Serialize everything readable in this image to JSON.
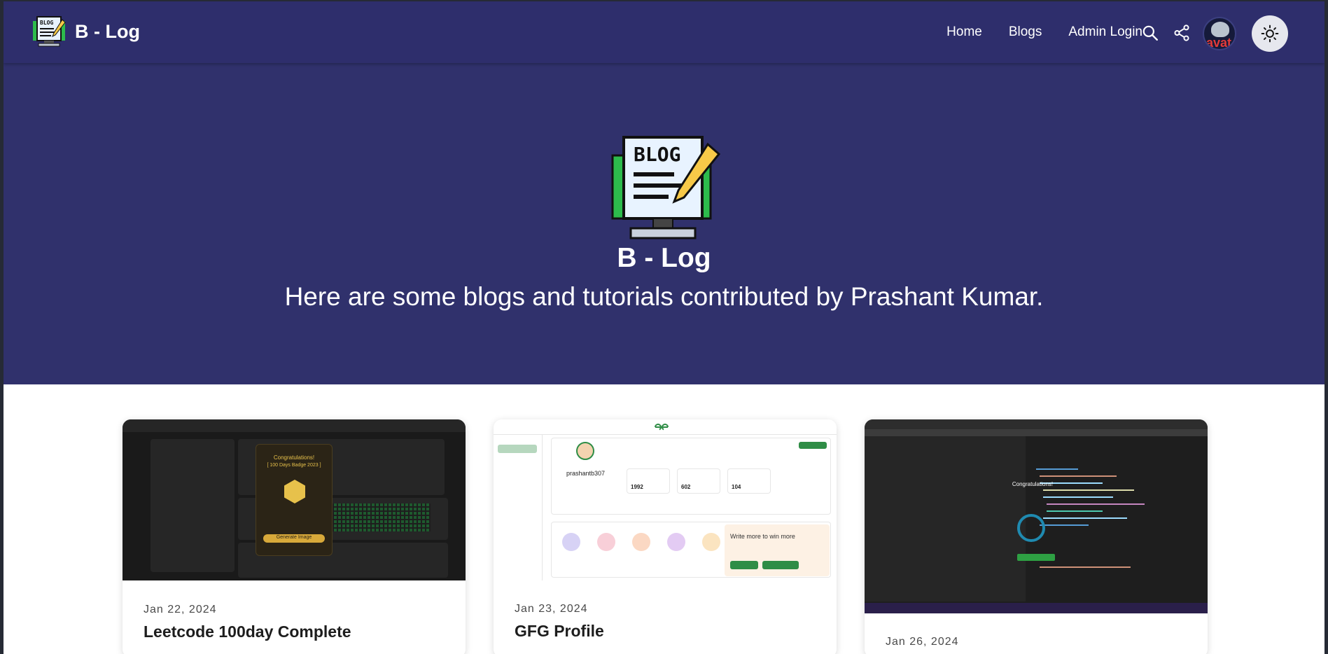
{
  "navbar": {
    "brand": "B - Log",
    "links": [
      "Home",
      "Blogs",
      "Admin Login"
    ],
    "avatar_alt": "avat"
  },
  "hero": {
    "logo_text": "BLOG",
    "title": "B - Log",
    "subtitle": "Here are some blogs and tutorials contributed by Prashant Kumar."
  },
  "cards": [
    {
      "date": "Jan 22, 2024",
      "title": "Leetcode 100day Complete"
    },
    {
      "date": "Jan 23, 2024",
      "title": "GFG Profile"
    },
    {
      "date": "Jan 26, 2024",
      "title": ""
    }
  ],
  "thumbs": {
    "gfg_username": "prashantb307",
    "gfg_stats": [
      "1992",
      "602",
      "104"
    ],
    "gfg_promo": "Write more to win more",
    "leet_popup_title": "Congratulations!",
    "leet_popup_badge": "[ 100 Days Badge 2023 ]",
    "leet_popup_button": "Generate Image",
    "vscode_modal": "Congratulations!"
  },
  "colors": {
    "navbar": "#2e2e6c",
    "hero": "#30316c",
    "accent_green": "#2f8d46"
  }
}
